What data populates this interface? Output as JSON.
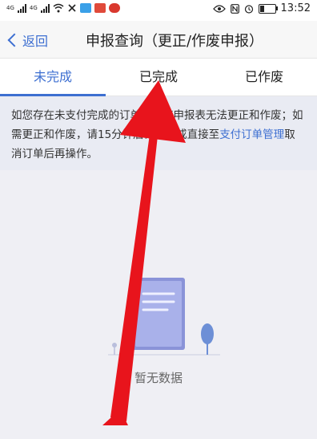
{
  "status_bar": {
    "network_1": "4G",
    "network_2": "4G",
    "time": "13:52",
    "icons": [
      "signal-icon",
      "wifi-icon",
      "app-notification-icon",
      "eye-icon",
      "nfc-icon",
      "alarm-icon",
      "battery-icon"
    ]
  },
  "header": {
    "back_label": "返回",
    "title": "申报查询（更正/作废申报）"
  },
  "tabs": [
    {
      "label": "未完成",
      "active": true
    },
    {
      "label": "已完成",
      "active": false
    },
    {
      "label": "已作废",
      "active": false
    }
  ],
  "notice": {
    "text_before": "如您存在未支付完成的订单，则该申报表无法更正和作废；如需更正和作废，请15分钟后再试，或直接至",
    "link_text": "支付订单管理",
    "text_after": "取消订单后再操作。"
  },
  "empty_state": {
    "text": "暂无数据"
  },
  "colors": {
    "accent": "#3d6fd1",
    "annotation": "#e8141c"
  }
}
